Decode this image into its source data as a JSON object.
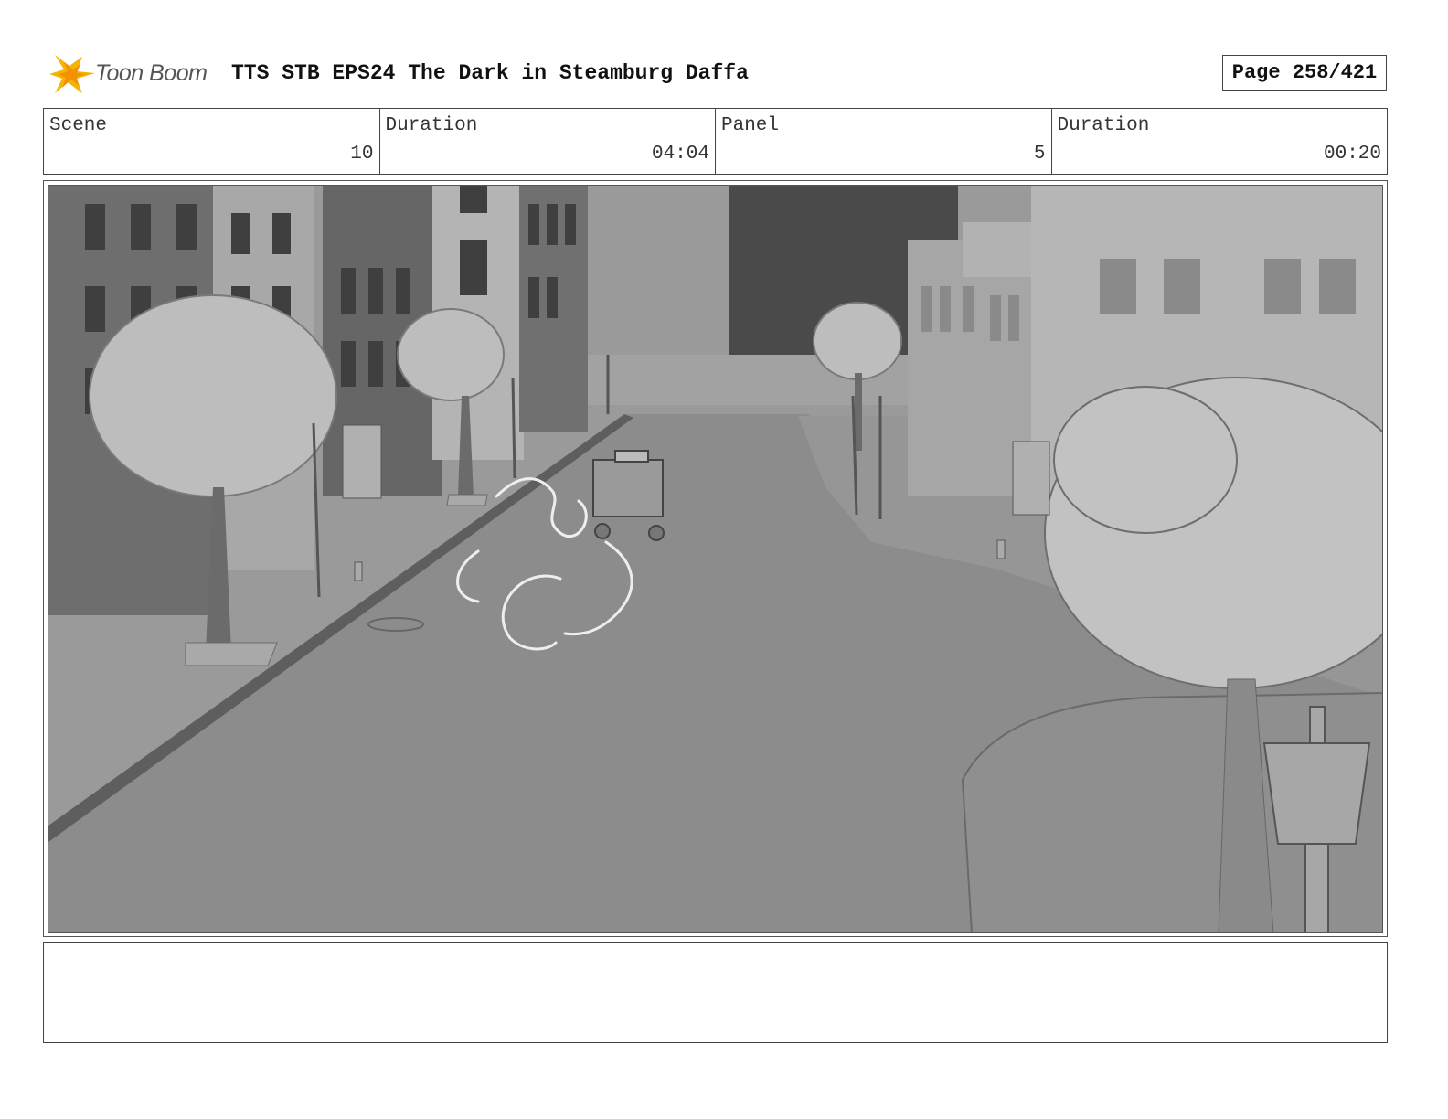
{
  "header": {
    "logo_text": "Toon Boom",
    "title": "TTS STB EPS24 The Dark in Steamburg Daffa",
    "page": "Page 258/421"
  },
  "info": {
    "scene_label": "Scene",
    "scene_value": "10",
    "scene_duration_label": "Duration",
    "scene_duration_value": "04:04",
    "panel_label": "Panel",
    "panel_value": "5",
    "panel_duration_label": "Duration",
    "panel_duration_value": "00:20"
  },
  "notes": {
    "text": ""
  },
  "colors": {
    "logo_yellow": "#f5b400",
    "logo_orange": "#f39200",
    "frame_border": "#444444"
  }
}
